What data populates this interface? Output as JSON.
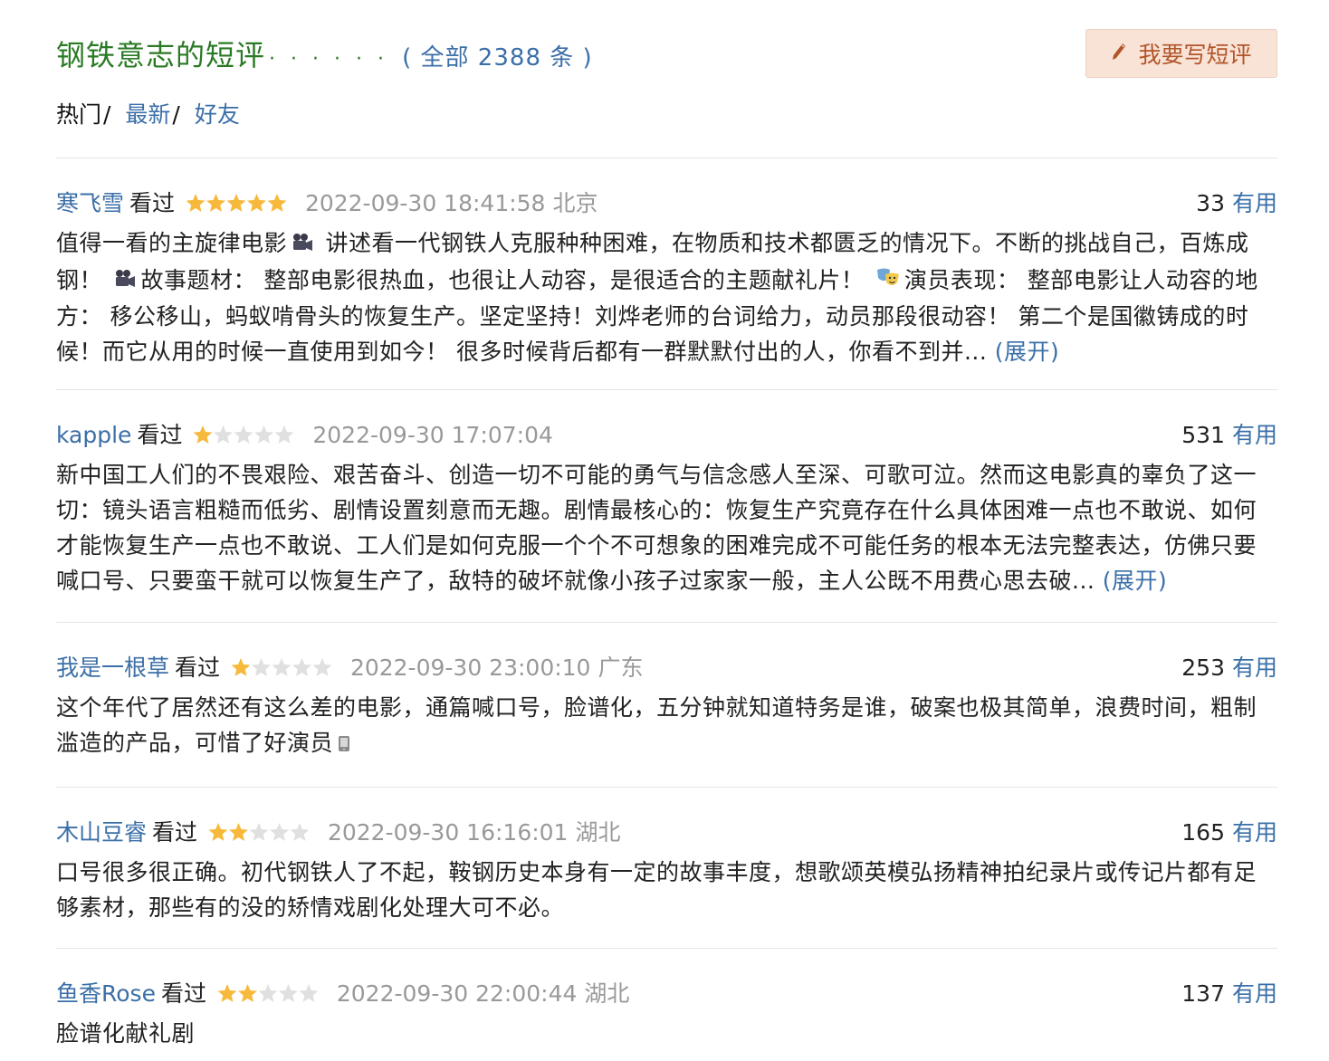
{
  "header": {
    "title": "钢铁意志的短评",
    "dots": "· · · · · ·",
    "total_open": "(",
    "total_label": "全部 2388 条",
    "total_close": ")",
    "write_label": "我要写短评"
  },
  "tabs": [
    {
      "label": "热门",
      "sep": "/"
    },
    {
      "label": "最新",
      "sep": "/"
    },
    {
      "label": "好友",
      "sep": ""
    }
  ],
  "colors": {
    "link": "#3b6fa8",
    "title_green": "#2a7a24",
    "star": "#f7b93b",
    "star_empty": "#e0e0e0"
  },
  "comments": [
    {
      "author": "寒飞雪",
      "status": "看过",
      "rating": 5,
      "time": "2022-09-30 18:41:58",
      "location": "北京",
      "votes": "33",
      "useful": "有用",
      "text_parts": [
        "值得一看的主旋律电影",
        " 讲述看一代钢铁人克服种种困难，在物质和技术都匮乏的情况下。不断的挑战自己，百炼成钢！ ",
        "故事题材： 整部电影很热血，也很让人动容，是很适合的主题献礼片！ ",
        "演员表现： 整部电影让人动容的地方： 移公移山，蚂蚁啃骨头的恢复生产。坚定坚持！刘烨老师的台词给力，动员那段很动容！ 第二个是国徽铸成的时候！而它从用的时候一直使用到如今！ 很多时候背后都有一群默默付出的人，你看不到并... "
      ],
      "expand": "(展开)"
    },
    {
      "author": "kapple",
      "status": "看过",
      "rating": 1,
      "time": "2022-09-30 17:07:04",
      "location": "",
      "votes": "531",
      "useful": "有用",
      "text": "新中国工人们的不畏艰险、艰苦奋斗、创造一切不可能的勇气与信念感人至深、可歌可泣。然而这电影真的辜负了这一切：镜头语言粗糙而低劣、剧情设置刻意而无趣。剧情最核心的：恢复生产究竟存在什么具体困难一点也不敢说、如何才能恢复生产一点也不敢说、工人们是如何克服一个个不可想象的困难完成不可能任务的根本无法完整表达，仿佛只要喊口号、只要蛮干就可以恢复生产了，敌特的破坏就像小孩子过家家一般，主人公既不用费心思去破... ",
      "expand": "(展开)"
    },
    {
      "author": "我是一根草",
      "status": "看过",
      "rating": 1,
      "time": "2022-09-30 23:00:10",
      "location": "广东",
      "votes": "253",
      "useful": "有用",
      "text": "这个年代了居然还有这么差的电影，通篇喊口号，脸谱化，五分钟就知道特务是谁，破案也极其简单，浪费时间，粗制滥造的产品，可惜了好演员"
    },
    {
      "author": "木山豆睿",
      "status": "看过",
      "rating": 2,
      "time": "2022-09-30 16:16:01",
      "location": "湖北",
      "votes": "165",
      "useful": "有用",
      "text": "口号很多很正确。初代钢铁人了不起，鞍钢历史本身有一定的故事丰度，想歌颂英模弘扬精神拍纪录片或传记片都有足够素材，那些有的没的矫情戏剧化处理大可不必。"
    },
    {
      "author": "鱼香Rose",
      "status": "看过",
      "rating": 2,
      "time": "2022-09-30 22:00:44",
      "location": "湖北",
      "votes": "137",
      "useful": "有用",
      "text": "脸谱化献礼剧"
    }
  ]
}
